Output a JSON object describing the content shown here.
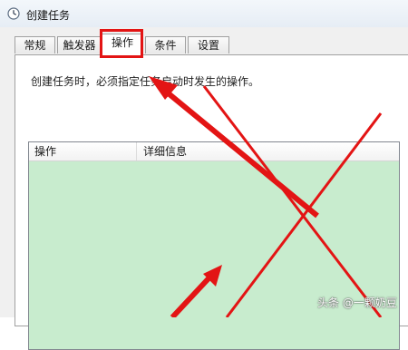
{
  "window": {
    "title": "创建任务",
    "icon": "clock-icon"
  },
  "tabs": [
    {
      "label": "常规",
      "active": false
    },
    {
      "label": "触发器",
      "active": false
    },
    {
      "label": "操作",
      "active": true
    },
    {
      "label": "条件",
      "active": false
    },
    {
      "label": "设置",
      "active": false
    }
  ],
  "panel": {
    "description": "创建任务时，必须指定任务启动时发生的操作。",
    "list": {
      "columns": [
        "操作",
        "详细信息"
      ],
      "rows": []
    }
  },
  "annotations": {
    "highlight_color": "#e31414",
    "list_background": "#c8ecce"
  },
  "watermark": "头条 @一颗奶豆"
}
